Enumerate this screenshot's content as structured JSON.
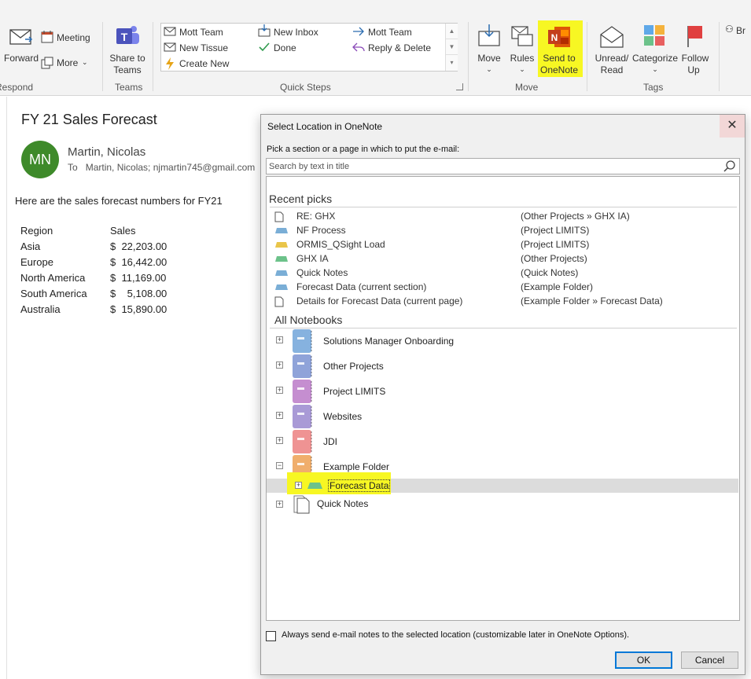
{
  "ribbon": {
    "respond": {
      "forward": "Forward",
      "meeting": "Meeting",
      "more": "More",
      "group_label": "Respond"
    },
    "teams": {
      "share": "Share to",
      "share2": "Teams",
      "group_label": "Teams"
    },
    "quick_steps": {
      "items": [
        "Mott Team",
        "New Tissue",
        "Create New",
        "New Inbox",
        "Done",
        "Mott Team",
        "Reply & Delete"
      ],
      "group_label": "Quick Steps"
    },
    "move": {
      "move": "Move",
      "rules": "Rules",
      "onenote1": "Send to",
      "onenote2": "OneNote",
      "group_label": "Move"
    },
    "tags": {
      "unread1": "Unread/",
      "unread2": "Read",
      "categorize": "Categorize",
      "follow1": "Follow",
      "follow2": "Up",
      "group_label": "Tags"
    },
    "browse_partial": "Br"
  },
  "email": {
    "subject": "FY 21 Sales Forecast",
    "avatar_initials": "MN",
    "sender": "Martin, Nicolas",
    "to_label": "To",
    "to_value": "Martin, Nicolas; njmartin745@gmail.com",
    "body": "Here are the sales forecast numbers for FY21",
    "table": {
      "headers": [
        "Region",
        "Sales"
      ],
      "rows": [
        [
          "Asia",
          "$  22,203.00"
        ],
        [
          "Europe",
          "$  16,442.00"
        ],
        [
          "North America",
          "$  11,169.00"
        ],
        [
          "South America",
          "$    5,108.00"
        ],
        [
          "Australia",
          "$  15,890.00"
        ]
      ]
    }
  },
  "dialog": {
    "title": "Select Location in OneNote",
    "close": "✕",
    "prompt": "Pick a section or a page in which to put the e-mail:",
    "search_placeholder": "Search by text in title",
    "recent_header": "Recent picks",
    "recent": [
      {
        "name": "RE: GHX",
        "location": "(Other Projects » GHX IA)",
        "icon": "page-icon",
        "color": ""
      },
      {
        "name": "NF Process",
        "location": "(Project LIMITS)",
        "icon": "section-icon",
        "color": "#7aaed6"
      },
      {
        "name": "ORMIS_QSight Load",
        "location": "(Project LIMITS)",
        "icon": "section-icon",
        "color": "#e9c54a"
      },
      {
        "name": "GHX IA",
        "location": "(Other Projects)",
        "icon": "section-icon",
        "color": "#6cc28a"
      },
      {
        "name": "Quick Notes",
        "location": "(Quick Notes)",
        "icon": "section-icon",
        "color": "#7aaed6"
      },
      {
        "name": "Forecast Data (current section)",
        "location": "(Example Folder)",
        "icon": "section-icon",
        "color": "#7aaed6"
      },
      {
        "name": "Details for Forecast Data (current page)",
        "location": "(Example Folder » Forecast Data)",
        "icon": "page-icon",
        "color": ""
      }
    ],
    "all_header": "All Notebooks",
    "notebooks": [
      {
        "name": "Solutions Manager Onboarding",
        "color": "#86b2df",
        "expander": "+"
      },
      {
        "name": "Other Projects",
        "color": "#8fa3d9",
        "expander": "+"
      },
      {
        "name": "Project LIMITS",
        "color": "#c58ed0",
        "expander": "+"
      },
      {
        "name": "Websites",
        "color": "#a99ad6",
        "expander": "+"
      },
      {
        "name": "JDI",
        "color": "#ef9393",
        "expander": "+"
      },
      {
        "name": "Example Folder",
        "color": "#f0ae6c",
        "expander": "−"
      }
    ],
    "selected_section": "Forecast Data",
    "quick_notes": "Quick Notes",
    "checkbox_label": "Always send e-mail notes to the selected location (customizable later in OneNote Options).",
    "ok": "OK",
    "cancel": "Cancel"
  }
}
